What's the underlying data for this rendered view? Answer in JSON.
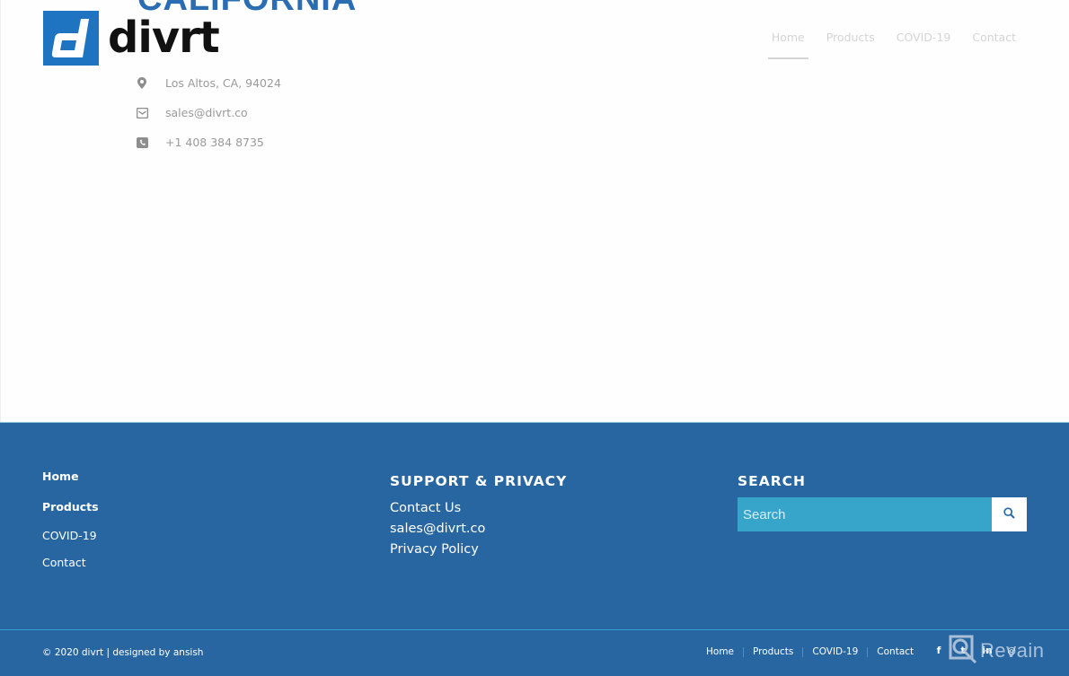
{
  "header": {
    "section_heading": "CALIFORNIA",
    "logo_text": "divrt",
    "nav": [
      {
        "label": "Home",
        "active": true
      },
      {
        "label": "Products",
        "active": false
      },
      {
        "label": "COVID-19",
        "active": false
      },
      {
        "label": "Contact",
        "active": false
      }
    ]
  },
  "contact_info": [
    {
      "icon": "map-pin-icon",
      "text": "Los Altos, CA, 94024"
    },
    {
      "icon": "envelope-icon",
      "text": "sales@divrt.co"
    },
    {
      "icon": "phone-icon",
      "text": "+1 408 384 8735"
    }
  ],
  "footer": {
    "nav_links": [
      "Home",
      "Products",
      "COVID-19",
      "Contact"
    ],
    "support": {
      "title": "SUPPORT & PRIVACY",
      "links": [
        "Contact Us",
        "sales@divrt.co",
        "Privacy Policy"
      ]
    },
    "search": {
      "title": "SEARCH",
      "placeholder": "Search"
    }
  },
  "socket": {
    "copyright": "© 2020 divrt | designed by ansish",
    "links": [
      "Home",
      "Products",
      "COVID-19",
      "Contact"
    ],
    "social": [
      {
        "icon": "facebook-icon",
        "glyph": "f"
      },
      {
        "icon": "twitter-icon",
        "glyph": "t"
      },
      {
        "icon": "linkedin-icon",
        "glyph": "in"
      },
      {
        "icon": "dribbble-icon",
        "glyph": "◎"
      }
    ]
  },
  "watermark": {
    "text": "Revain"
  },
  "colors": {
    "brand_blue": "#1f74c2",
    "footer_bg": "#2866a1",
    "search_bg": "#36a5c9"
  }
}
